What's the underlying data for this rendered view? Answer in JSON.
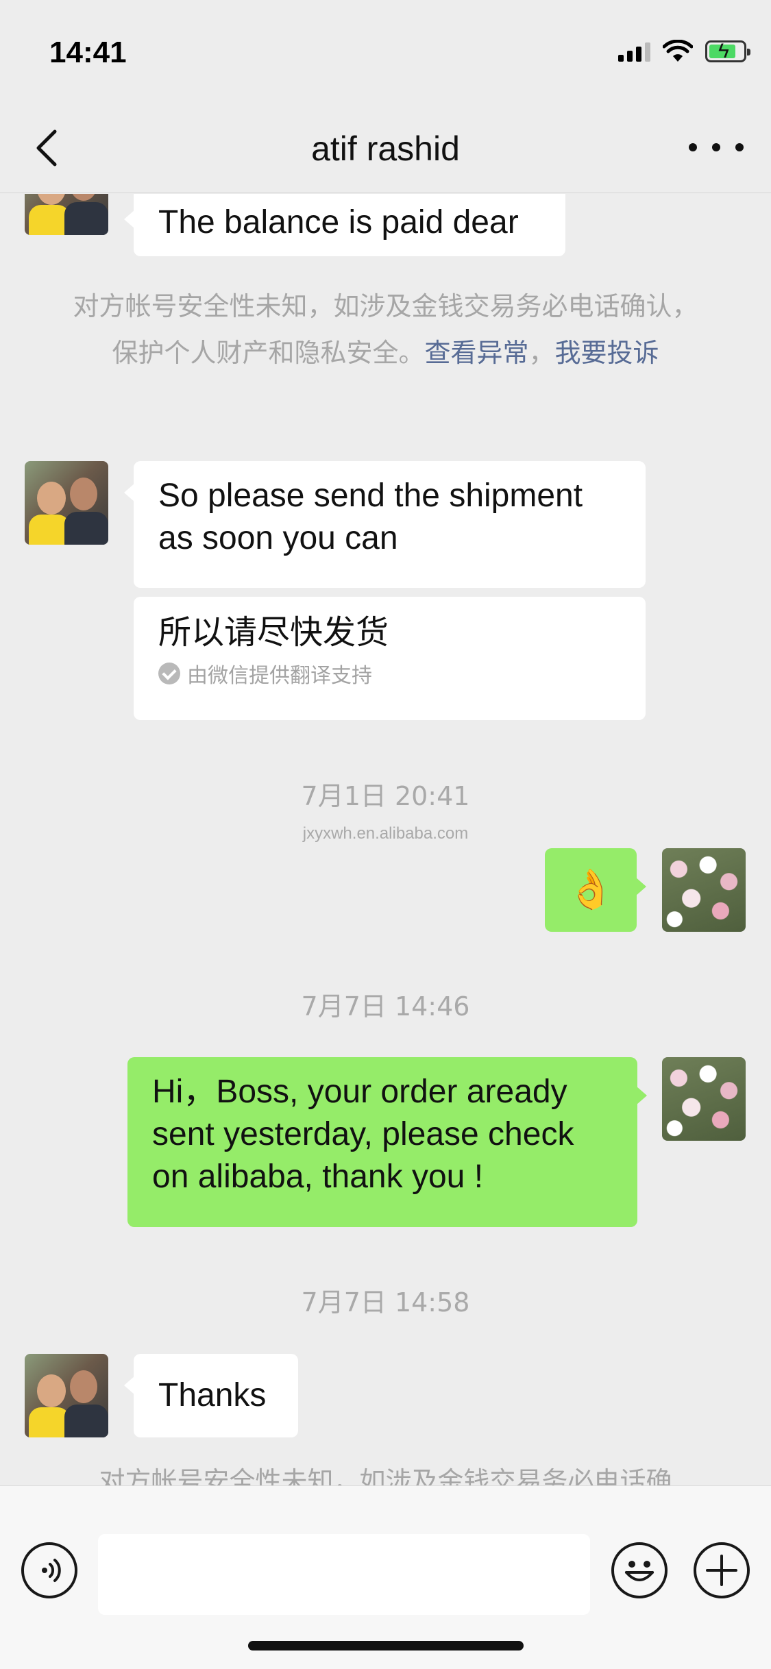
{
  "status_bar": {
    "time": "14:41",
    "signal": "signal-icon",
    "wifi": "wifi-icon",
    "battery": "battery-charging-icon"
  },
  "nav": {
    "title": "atif rashid",
    "back_icon": "chevron-left-icon",
    "more_icon": "ellipsis-icon"
  },
  "colors": {
    "background": "#ededed",
    "incoming_bubble": "#ffffff",
    "outgoing_bubble": "#95ec69",
    "link": "#576b95",
    "muted_text": "#a6a6a6"
  },
  "messages": [
    {
      "side": "in",
      "text": "The balance is paid dear"
    },
    {
      "type": "notice",
      "text": "对方帐号安全性未知，如涉及金钱交易务必电话确认，保护个人财产和隐私安全。",
      "link1": "查看异常",
      "separator": "，",
      "link2": "我要投诉"
    },
    {
      "side": "in",
      "text": "So please send the shipment as soon you can",
      "translation": "所以请尽快发货",
      "translation_note": "由微信提供翻译支持"
    },
    {
      "type": "timestamp",
      "text": "7月1日 20:41",
      "source": "jxyxwh.en.alibaba.com"
    },
    {
      "side": "out",
      "text": "👌"
    },
    {
      "type": "timestamp",
      "text": "7月7日 14:46"
    },
    {
      "side": "out",
      "text": "Hi，Boss, your order aready sent yesterday, please check on alibaba, thank you !"
    },
    {
      "type": "timestamp",
      "text": "7月7日 14:58"
    },
    {
      "side": "in",
      "text": "Thanks"
    },
    {
      "type": "notice",
      "text": "对方帐号安全性未知，如涉及金钱交易务必电话确"
    }
  ],
  "input_bar": {
    "voice_icon": "voice-icon",
    "input_value": "",
    "emoji_icon": "emoji-icon",
    "plus_icon": "plus-icon"
  }
}
